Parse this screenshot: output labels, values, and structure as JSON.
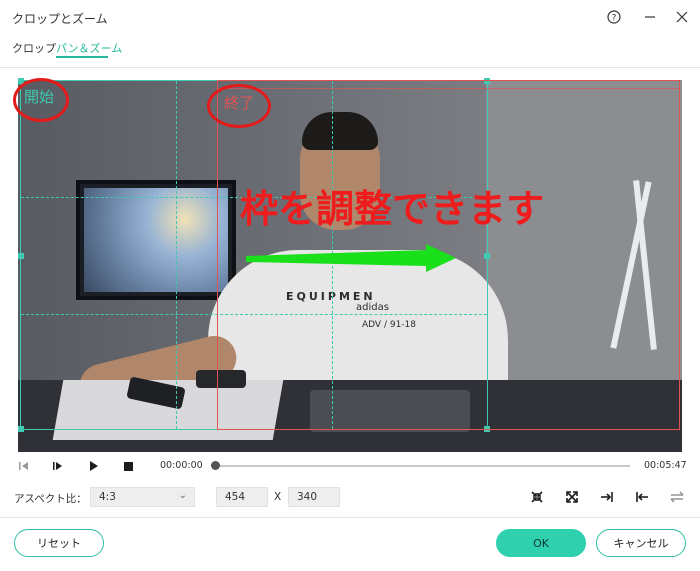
{
  "window": {
    "title": "クロップとズーム",
    "help_icon": "question-circle-icon",
    "minimize_icon": "minimize-icon",
    "close_icon": "close-icon"
  },
  "tabs": [
    {
      "label": "クロップ",
      "active": false
    },
    {
      "label": "パン＆ズーム",
      "active": true
    }
  ],
  "preview": {
    "start_label": "開始",
    "end_label": "終了",
    "annotation": "枠を調整できます",
    "shirt_text": "EQUIPMEN",
    "shirt_brand": "adidas",
    "shirt_sub": "ADV / 91-18",
    "colors": {
      "start_frame": "#3ec9b0",
      "end_frame": "#e05454",
      "annotation": "#ee1c1c",
      "arrow": "#19e01a"
    }
  },
  "player": {
    "current_time": "00:00:00",
    "total_time": "00:05:47",
    "progress": 0.0,
    "icons": [
      "step-back-icon",
      "frame-play-icon",
      "play-icon",
      "stop-icon"
    ]
  },
  "aspect": {
    "label": "アスペクト比：",
    "selected": "4:3",
    "width": "454",
    "separator": "X",
    "height": "340",
    "tools": [
      "collapse-icon",
      "expand-icon",
      "align-right-icon",
      "align-left-icon",
      "swap-icon"
    ]
  },
  "footer": {
    "reset_label": "リセット",
    "ok_label": "OK",
    "cancel_label": "キャンセル",
    "accent": "#2fd0ad"
  }
}
